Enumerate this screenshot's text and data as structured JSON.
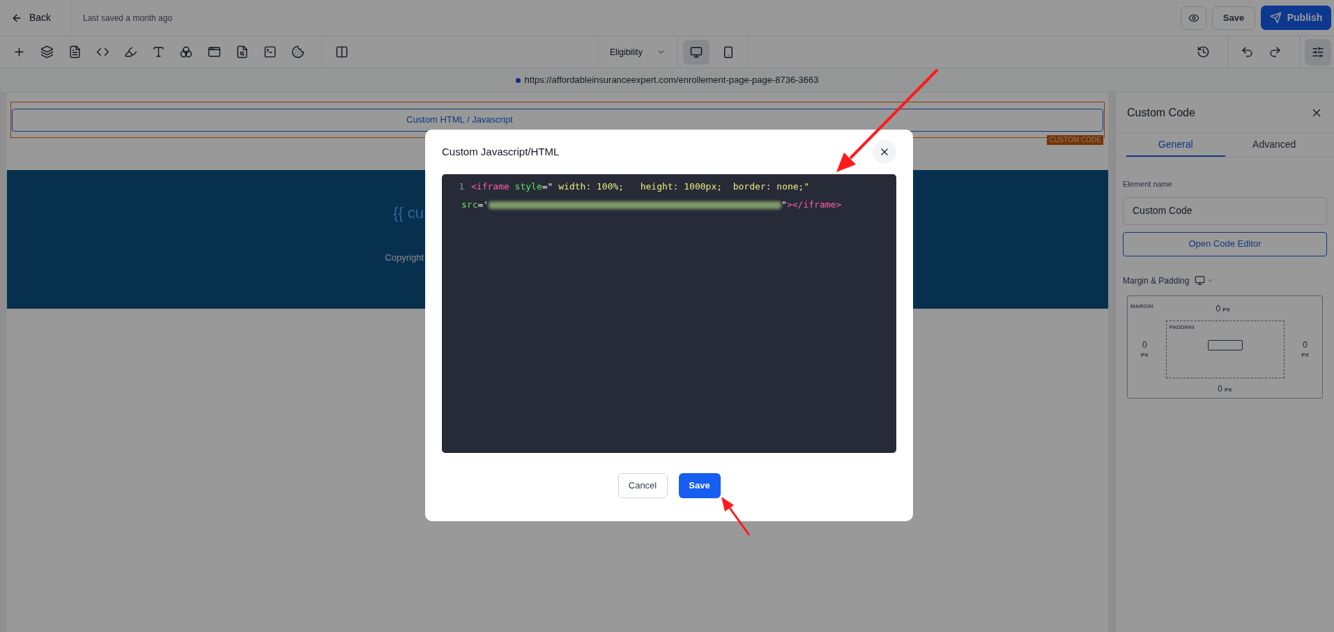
{
  "top_bar": {
    "back": "Back",
    "last_saved": "Last saved a month ago",
    "save": "Save",
    "publish": "Publish"
  },
  "toolbar": {
    "page_select": "Eligibility",
    "devices": [
      {
        "kind": "desktop",
        "selected": true
      },
      {
        "kind": "mobile",
        "selected": false
      }
    ]
  },
  "url_bar": {
    "url": "https://affordableinsuranceexpert.com/enrollement-page-page-8736-3663"
  },
  "canvas": {
    "element_label": "Custom HTML / Javascript",
    "element_badge": "CUSTOM CODE",
    "footer_heading": "{{ cu",
    "footer_copyright": "Copyright"
  },
  "side_panel": {
    "title": "Custom Code",
    "tabs": [
      {
        "label": "General",
        "selected": true
      },
      {
        "label": "Advanced",
        "selected": false
      }
    ],
    "element_name_label": "Element name",
    "element_name_value": "Custom Code",
    "open_editor": "Open Code Editor",
    "spacing_title": "Margin & Padding",
    "margin_label": "MARGIN",
    "padding_label": "PADDING",
    "margin_top": {
      "value": "0",
      "unit": "PX"
    },
    "margin_left": {
      "value": "0",
      "unit": "PX"
    },
    "margin_right": {
      "value": "0",
      "unit": "PX"
    },
    "margin_bottom": {
      "value": "0",
      "unit": "PX"
    }
  },
  "modal": {
    "title": "Custom Javascript/HTML",
    "visual_lines": [
      {
        "number": "1",
        "segments": [
          {
            "kind": "tag",
            "text": "<iframe"
          },
          {
            "kind": "attr",
            "text": " style"
          },
          {
            "kind": "punct",
            "text": "=\""
          },
          {
            "kind": "string",
            "text": " width: 100%;   height: 1000px;  border: none;\""
          }
        ]
      },
      {
        "segments": [
          {
            "kind": "attr",
            "text": "src"
          },
          {
            "kind": "punct",
            "text": "='"
          },
          {
            "kind": "redacted"
          },
          {
            "kind": "punct",
            "text": "\""
          },
          {
            "kind": "tag",
            "text": "></iframe>"
          }
        ]
      }
    ],
    "cancel": "Cancel",
    "save": "Save"
  }
}
